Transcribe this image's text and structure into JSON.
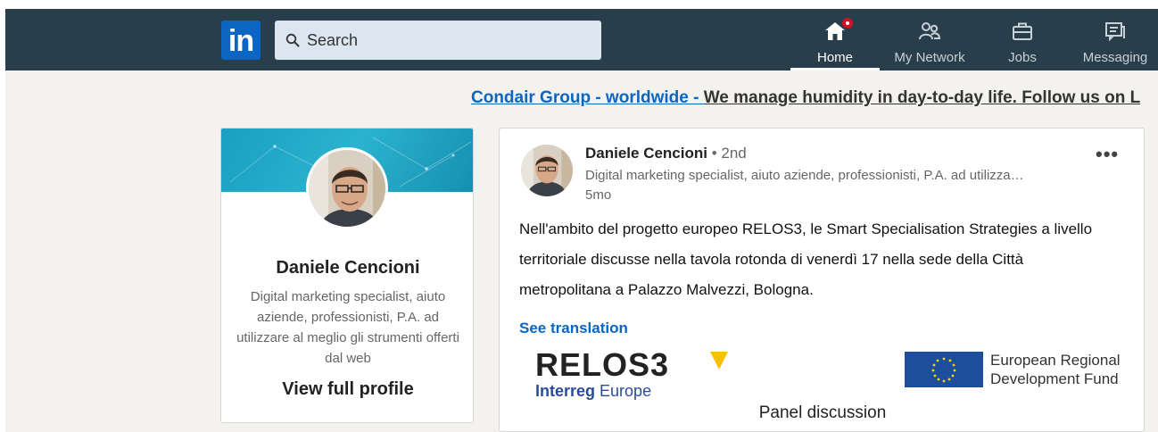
{
  "header": {
    "logo": "in",
    "search": {
      "placeholder": "Search"
    },
    "nav": [
      {
        "label": "Home",
        "icon": "home-icon",
        "active": true,
        "badge": true
      },
      {
        "label": "My Network",
        "icon": "network-icon"
      },
      {
        "label": "Jobs",
        "icon": "briefcase-icon"
      },
      {
        "label": "Messaging",
        "icon": "messaging-icon"
      }
    ]
  },
  "ad": {
    "link": "Condair Group - worldwide - ",
    "text": "We manage humidity in day-to-day life. Follow us on L"
  },
  "profile": {
    "name": "Daniele Cencioni",
    "headline": "Digital marketing specialist, aiuto aziende, professionisti, P.A. ad utilizzare al meglio gli strumenti offerti dal web",
    "cta": "View full profile"
  },
  "post": {
    "author": "Daniele Cencioni",
    "degree": " • 2nd",
    "headline": "Digital marketing specialist, aiuto aziende, professionisti, P.A. ad utilizza…",
    "time": "5mo",
    "more": "•••",
    "text": "Nell'ambito del progetto europeo RELOS3, le Smart Specialisation Strategies a livello territoriale discusse nella tavola rotonda di venerdì 17 nella sede della Città metropolitana a Palazzo Malvezzi, Bologna.",
    "see_translation": "See translation",
    "image": {
      "relos_title": "RELOS3",
      "relos_sub_bold": "Interreg",
      "relos_sub_normal": " Europe",
      "eu_text": "European Regional\nDevelopment Fund",
      "caption": "Panel discussion"
    }
  },
  "colors": {
    "header_bg": "#283e4a",
    "brand_blue": "#0a66c2",
    "badge_red": "#d11124"
  }
}
